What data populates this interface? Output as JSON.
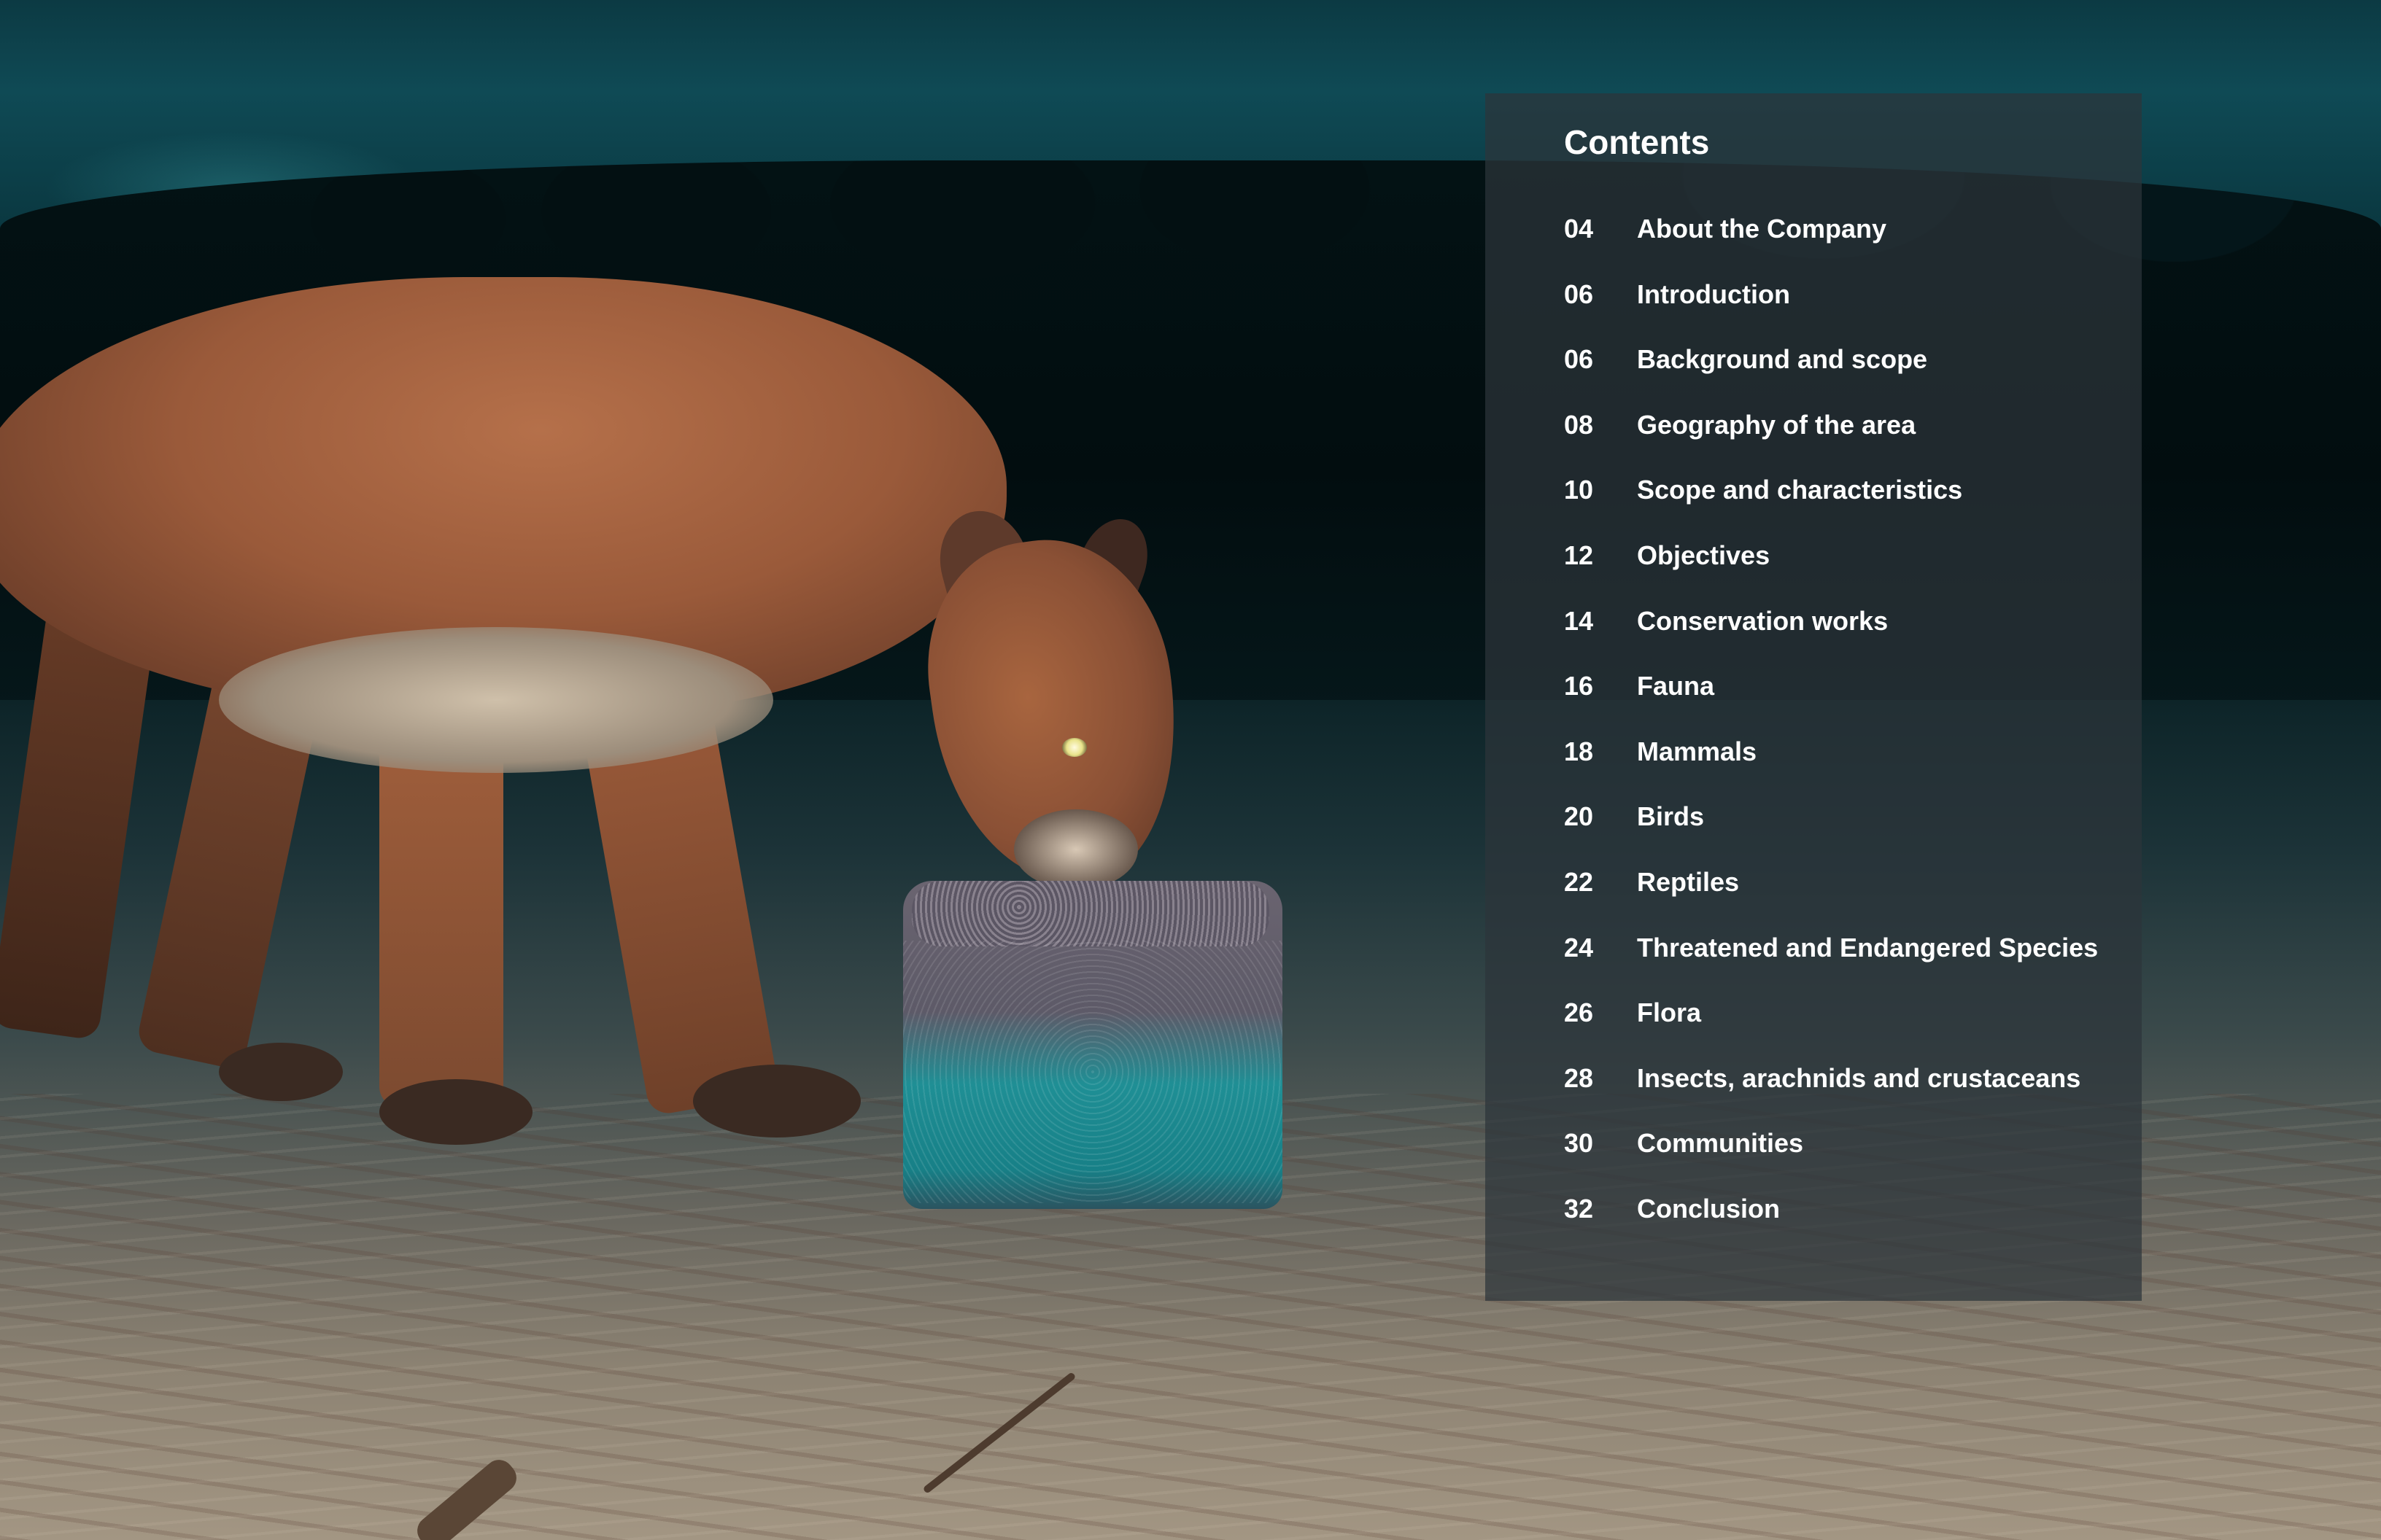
{
  "contents": {
    "title": "Contents",
    "items": [
      {
        "page": "04",
        "label": "About the Company"
      },
      {
        "page": "06",
        "label": "Introduction"
      },
      {
        "page": "06",
        "label": "Background and scope"
      },
      {
        "page": "08",
        "label": "Geography of the area"
      },
      {
        "page": "10",
        "label": "Scope and characteristics"
      },
      {
        "page": "12",
        "label": "Objectives"
      },
      {
        "page": "14",
        "label": "Conservation works"
      },
      {
        "page": "16",
        "label": "Fauna"
      },
      {
        "page": "18",
        "label": "Mammals"
      },
      {
        "page": "20",
        "label": "Birds"
      },
      {
        "page": "22",
        "label": "Reptiles"
      },
      {
        "page": "24",
        "label": "Threatened and Endangered Species"
      },
      {
        "page": "26",
        "label": "Flora"
      },
      {
        "page": "28",
        "label": "Insects, arachnids and crustaceans"
      },
      {
        "page": "30",
        "label": "Communities"
      },
      {
        "page": "32",
        "label": "Conclusion"
      }
    ]
  },
  "colors": {
    "panel_background": "#2c343a",
    "text": "#ffffff",
    "sky": "#0f4a55"
  }
}
